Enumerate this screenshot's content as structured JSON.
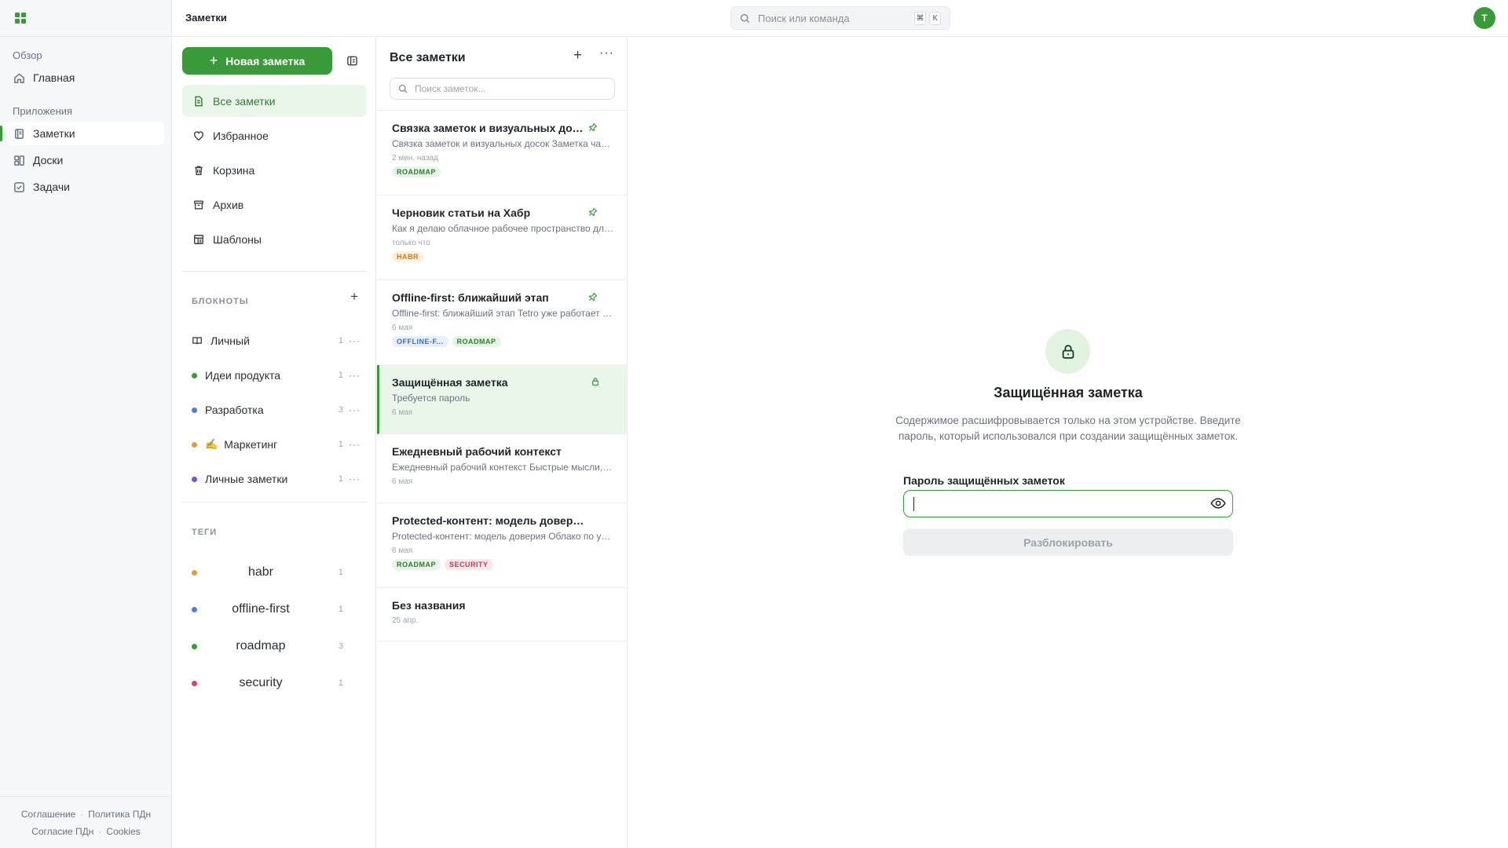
{
  "topbar": {
    "title": "Заметки",
    "search_placeholder": "Поиск или команда",
    "shortcut_mod": "⌘",
    "shortcut_key": "К",
    "avatar_initial": "Т"
  },
  "nav": {
    "overview_label": "Обзор",
    "home_label": "Главная",
    "apps_label": "Приложения",
    "apps": [
      {
        "label": "Заметки",
        "icon": "notes-icon",
        "active": true
      },
      {
        "label": "Доски",
        "icon": "boards-icon",
        "active": false
      },
      {
        "label": "Задачи",
        "icon": "tasks-icon",
        "active": false
      }
    ],
    "footer": {
      "agreement": "Соглашение",
      "privacy": "Политика ПДн",
      "consent": "Согласие ПДн",
      "cookies": "Cookies"
    }
  },
  "sidebar": {
    "new_note_label": "Новая заметка",
    "items": [
      {
        "label": "Все заметки",
        "icon": "file-icon",
        "active": true
      },
      {
        "label": "Избранное",
        "icon": "heart-icon",
        "active": false
      },
      {
        "label": "Корзина",
        "icon": "trash-icon",
        "active": false
      },
      {
        "label": "Архив",
        "icon": "archive-icon",
        "active": false
      },
      {
        "label": "Шаблоны",
        "icon": "template-icon",
        "active": false
      }
    ],
    "notebooks_heading": "БЛОКНОТЫ",
    "notebooks": [
      {
        "label": "Личный",
        "count": "1",
        "marker": "book-icon"
      },
      {
        "label": "Идеи продукта",
        "count": "1",
        "color": "#3a9a3a"
      },
      {
        "label": "Разработка",
        "count": "3",
        "color": "#4a7fd6"
      },
      {
        "label": "Маркетинг",
        "count": "1",
        "color": "#e39b3a",
        "emoji": "✍️"
      },
      {
        "label": "Личные заметки",
        "count": "1",
        "color": "#7a4fd6"
      }
    ],
    "tags_heading": "ТЕГИ",
    "tags": [
      {
        "label": "habr",
        "count": "1",
        "color": "#e39b3a"
      },
      {
        "label": "offline-first",
        "count": "1",
        "color": "#4a7fd6"
      },
      {
        "label": "roadmap",
        "count": "3",
        "color": "#3a9a3a"
      },
      {
        "label": "security",
        "count": "1",
        "color": "#d6456a"
      }
    ]
  },
  "note_list": {
    "title": "Все заметки",
    "search_placeholder": "Поиск заметок...",
    "notes": [
      {
        "title": "Связка заметок и визуальных досок",
        "excerpt": "Связка заметок и визуальных досок Заметка часть плана",
        "date": "2 мин. назад",
        "tags": [
          "ROADMAP"
        ],
        "pinned": true
      },
      {
        "title": "Черновик статьи на Хабр",
        "excerpt": "Как я делаю облачное рабочее пространство для заметок",
        "date": "только что",
        "tags": [
          "HABR"
        ],
        "pinned": true
      },
      {
        "title": "Offline-first: ближайший этап",
        "excerpt": "Offline-first: ближайший этап Tetro уже работает в браузере",
        "date": "6 мая",
        "tags": [
          "OFFLINE-F...",
          "ROADMAP"
        ],
        "pinned": true
      },
      {
        "title": "Защищённая заметка",
        "excerpt": "Требуется пароль",
        "date": "6 мая",
        "tags": [],
        "locked": true
      },
      {
        "title": "Ежедневный рабочий контекст",
        "excerpt": "Ежедневный рабочий контекст Быстрые мысли, задачи",
        "date": "6 мая",
        "tags": []
      },
      {
        "title": "Protected-контент: модель доверия",
        "excerpt": "Protected-контент: модель доверия Облако по умолчанию",
        "date": "6 мая",
        "tags": [
          "ROADMAP",
          "SECURITY"
        ]
      },
      {
        "title": "Без названия",
        "excerpt": "",
        "date": "25 апр.",
        "tags": []
      }
    ]
  },
  "locked": {
    "title": "Защищённая заметка",
    "description": "Содержимое расшифровывается только на этом устройстве. Введите пароль, который использовался при создании защищённых заметок.",
    "password_label": "Пароль защищённых заметок",
    "password_value": "",
    "unlock_label": "Разблокировать"
  },
  "colors": {
    "accent": "#3a9a3a",
    "accent_soft": "#ebf6ea"
  }
}
